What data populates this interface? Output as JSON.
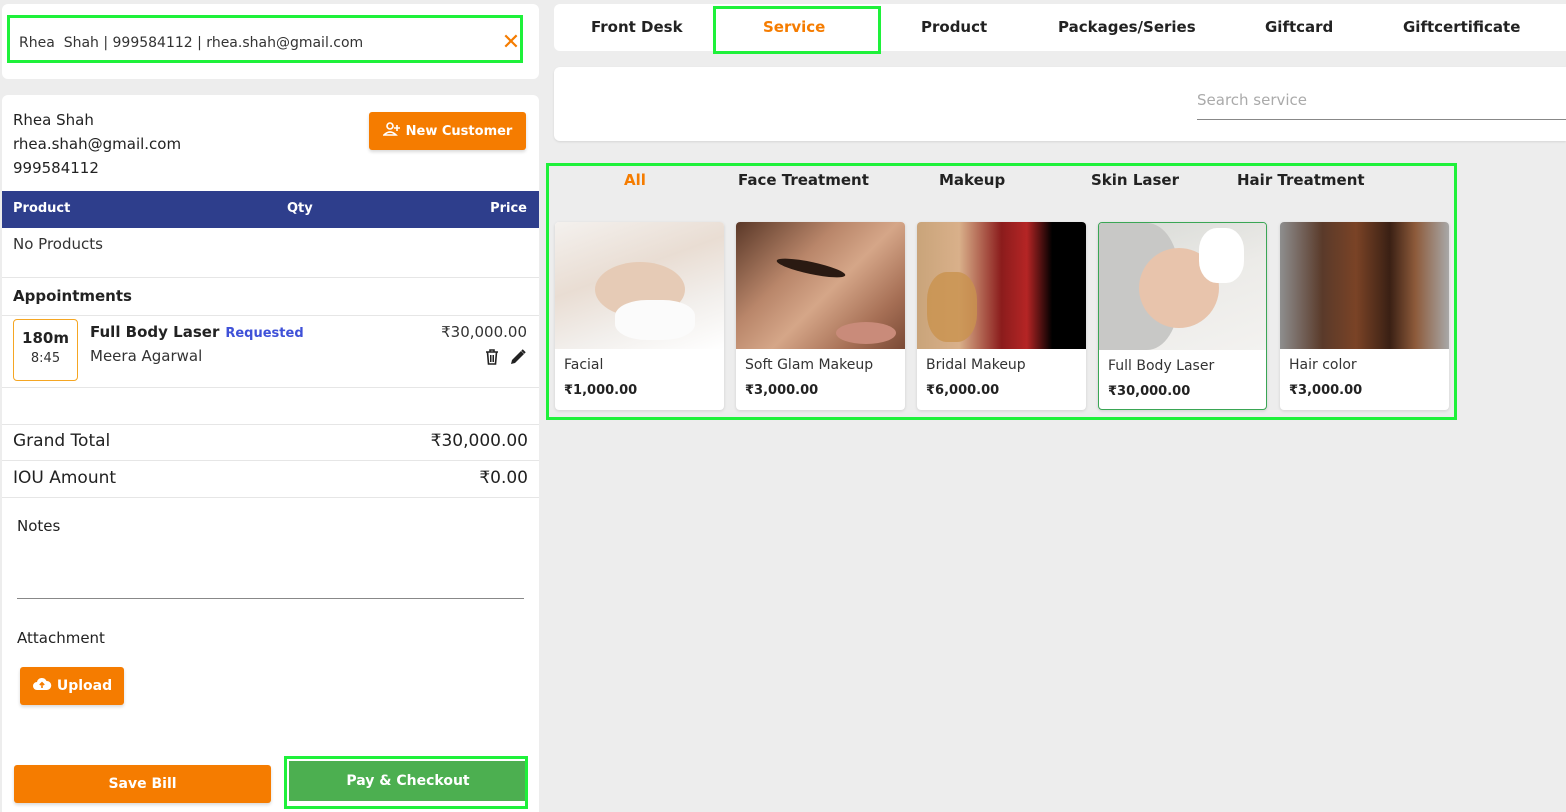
{
  "customer_search": {
    "value": "Rhea  Shah | 999584112 | rhea.shah@gmail.com",
    "clear_icon": "close-icon"
  },
  "customer": {
    "name": "Rhea Shah",
    "email": "rhea.shah@gmail.com",
    "phone": "999584112",
    "new_customer_label": "New Customer",
    "new_customer_icon": "user-plus-icon"
  },
  "products_table": {
    "columns": [
      "Product",
      "Qty",
      "Price"
    ],
    "empty_text": "No Products"
  },
  "appointments": {
    "title": "Appointments",
    "items": [
      {
        "duration": "180m",
        "time": "8:45",
        "service": "Full Body Laser",
        "status": "Requested",
        "staff": "Meera Agarwal",
        "price": "₹30,000.00"
      }
    ]
  },
  "totals": {
    "grand_total_label": "Grand Total",
    "grand_total_value": "₹30,000.00",
    "iou_label": "IOU Amount",
    "iou_value": "₹0.00"
  },
  "notes": {
    "label": "Notes",
    "value": ""
  },
  "attachment": {
    "label": "Attachment",
    "upload_label": "Upload",
    "upload_icon": "cloud-upload-icon"
  },
  "actions": {
    "save_bill": "Save Bill",
    "pay_checkout": "Pay & Checkout"
  },
  "tabs": [
    {
      "label": "Front Desk",
      "active": false
    },
    {
      "label": "Service",
      "active": true
    },
    {
      "label": "Product",
      "active": false
    },
    {
      "label": "Packages/Series",
      "active": false
    },
    {
      "label": "Giftcard",
      "active": false
    },
    {
      "label": "Giftcertificate",
      "active": false
    }
  ],
  "service_search": {
    "placeholder": "Search service",
    "value": ""
  },
  "categories": [
    {
      "label": "All",
      "active": true
    },
    {
      "label": "Face Treatment",
      "active": false
    },
    {
      "label": "Makeup",
      "active": false
    },
    {
      "label": "Skin Laser",
      "active": false
    },
    {
      "label": "Hair Treatment",
      "active": false
    }
  ],
  "services": [
    {
      "name": "Facial",
      "price": "₹1,000.00",
      "selected": false
    },
    {
      "name": "Soft Glam Makeup",
      "price": "₹3,000.00",
      "selected": false
    },
    {
      "name": "Bridal Makeup",
      "price": "₹6,000.00",
      "selected": false
    },
    {
      "name": "Full Body Laser",
      "price": "₹30,000.00",
      "selected": true
    },
    {
      "name": "Hair color",
      "price": "₹3,000.00",
      "selected": false
    }
  ],
  "colors": {
    "accent": "#f57c00",
    "table_header": "#2e3e8c",
    "checkout": "#4caf50",
    "status_requested": "#3f51d8",
    "highlight": "#1ef13a"
  }
}
